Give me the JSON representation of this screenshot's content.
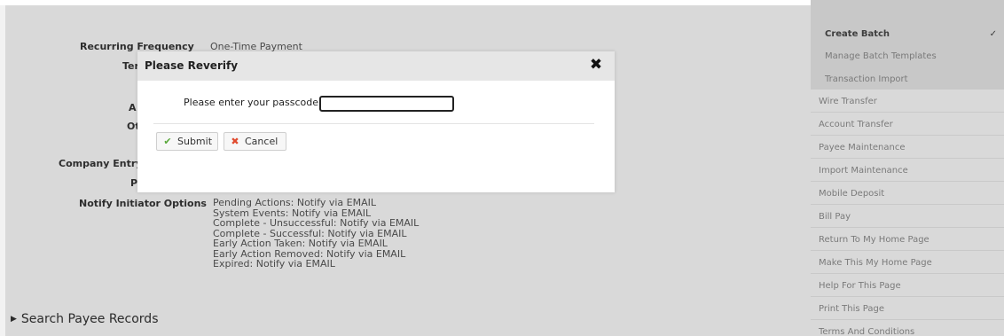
{
  "background_form": {
    "recurring_frequency_label": "Recurring Frequency",
    "recurring_frequency_value": "One-Time Payment",
    "ter_label_partial": "Ter",
    "a_label_partial": "A",
    "ot_label_partial": "Ot",
    "company_entry_label_partial": "Company Entry",
    "p_label_partial": "P",
    "notify_initiator_label": "Notify Initiator Options",
    "notify_items": [
      "Pending Actions: Notify via EMAIL",
      "System Events: Notify via EMAIL",
      "Complete - Unsuccessful: Notify via EMAIL",
      "Complete - Successful: Notify via EMAIL",
      "Early Action Taken: Notify via EMAIL",
      "Early Action Removed: Notify via EMAIL",
      "Expired: Notify via EMAIL"
    ],
    "search_payee_records": "Search Payee Records"
  },
  "sidebar": {
    "subitems": [
      {
        "label": "Create Batch",
        "active": true,
        "marker": "✓"
      },
      {
        "label": "Manage Batch Templates",
        "active": false
      },
      {
        "label": "Transaction Import",
        "active": false
      }
    ],
    "items": [
      {
        "label": "Wire Transfer"
      },
      {
        "label": "Account Transfer"
      },
      {
        "label": "Payee Maintenance"
      },
      {
        "label": "Import Maintenance"
      },
      {
        "label": "Mobile Deposit"
      },
      {
        "label": "Bill Pay"
      },
      {
        "label": "Return To My Home Page"
      },
      {
        "label": "Make This My Home Page"
      },
      {
        "label": "Help For This Page"
      },
      {
        "label": "Print This Page"
      },
      {
        "label": "Terms And Conditions"
      }
    ]
  },
  "modal": {
    "title": "Please Reverify",
    "close_glyph": "✖",
    "prompt": "Please enter your passcode",
    "passcode_value": "",
    "submit_label": "Submit",
    "submit_glyph": "✔",
    "cancel_label": "Cancel",
    "cancel_glyph": "✖"
  },
  "colors": {
    "submit_icon": "#59a83a",
    "cancel_icon": "#e04a2e",
    "overlay_gray": "#d9d9d9"
  }
}
